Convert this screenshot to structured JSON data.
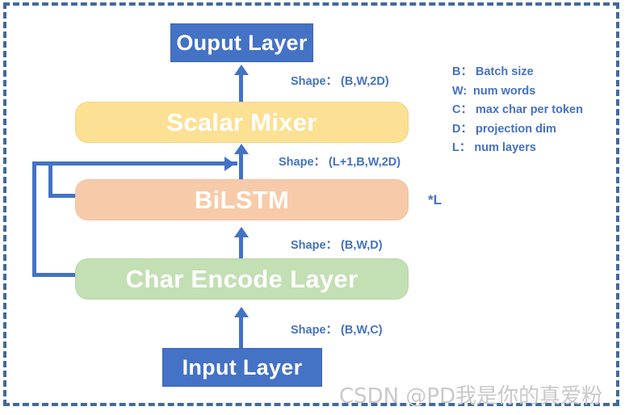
{
  "diagram": {
    "title": "ELMo model architecture flow diagram",
    "nodes": [
      {
        "id": "output",
        "label": "Ouput Layer",
        "color": "#4472c4"
      },
      {
        "id": "mixer",
        "label": "Scalar Mixer",
        "color": "#fce093"
      },
      {
        "id": "bilstm",
        "label": "BiLSTM",
        "color": "#f7cba9"
      },
      {
        "id": "charenc",
        "label": "Char Encode Layer",
        "color": "#c3dfb4"
      },
      {
        "id": "input",
        "label": "Input Layer",
        "color": "#4472c4"
      }
    ],
    "shape_labels": [
      {
        "id": "shape-output-mixer",
        "text": "Shape： (B,W,2D)"
      },
      {
        "id": "shape-mixer-bilstm",
        "text": "Shape： (L+1,B,W,2D)"
      },
      {
        "id": "shape-bilstm-char",
        "text": "Shape： (B,W,D)"
      },
      {
        "id": "shape-char-input",
        "text": "Shape： (B,W,C)"
      }
    ],
    "repeat_label": "*L",
    "legend": [
      {
        "key": "B：",
        "desc": "Batch size"
      },
      {
        "key": "W:",
        "desc": "num words"
      },
      {
        "key": "C：",
        "desc": "max char per token"
      },
      {
        "key": "D：",
        "desc": "projection dim"
      },
      {
        "key": "L：",
        "desc": "num layers"
      }
    ],
    "watermark": "CSDN @PD我是你的真爱粉",
    "colors": {
      "accent_blue": "#4472c4",
      "frame_blue": "#41699e",
      "yellow": "#fce093",
      "peach": "#f7cba9",
      "green": "#c3dfb4",
      "watermark_gray": "#c9c9c9"
    }
  }
}
